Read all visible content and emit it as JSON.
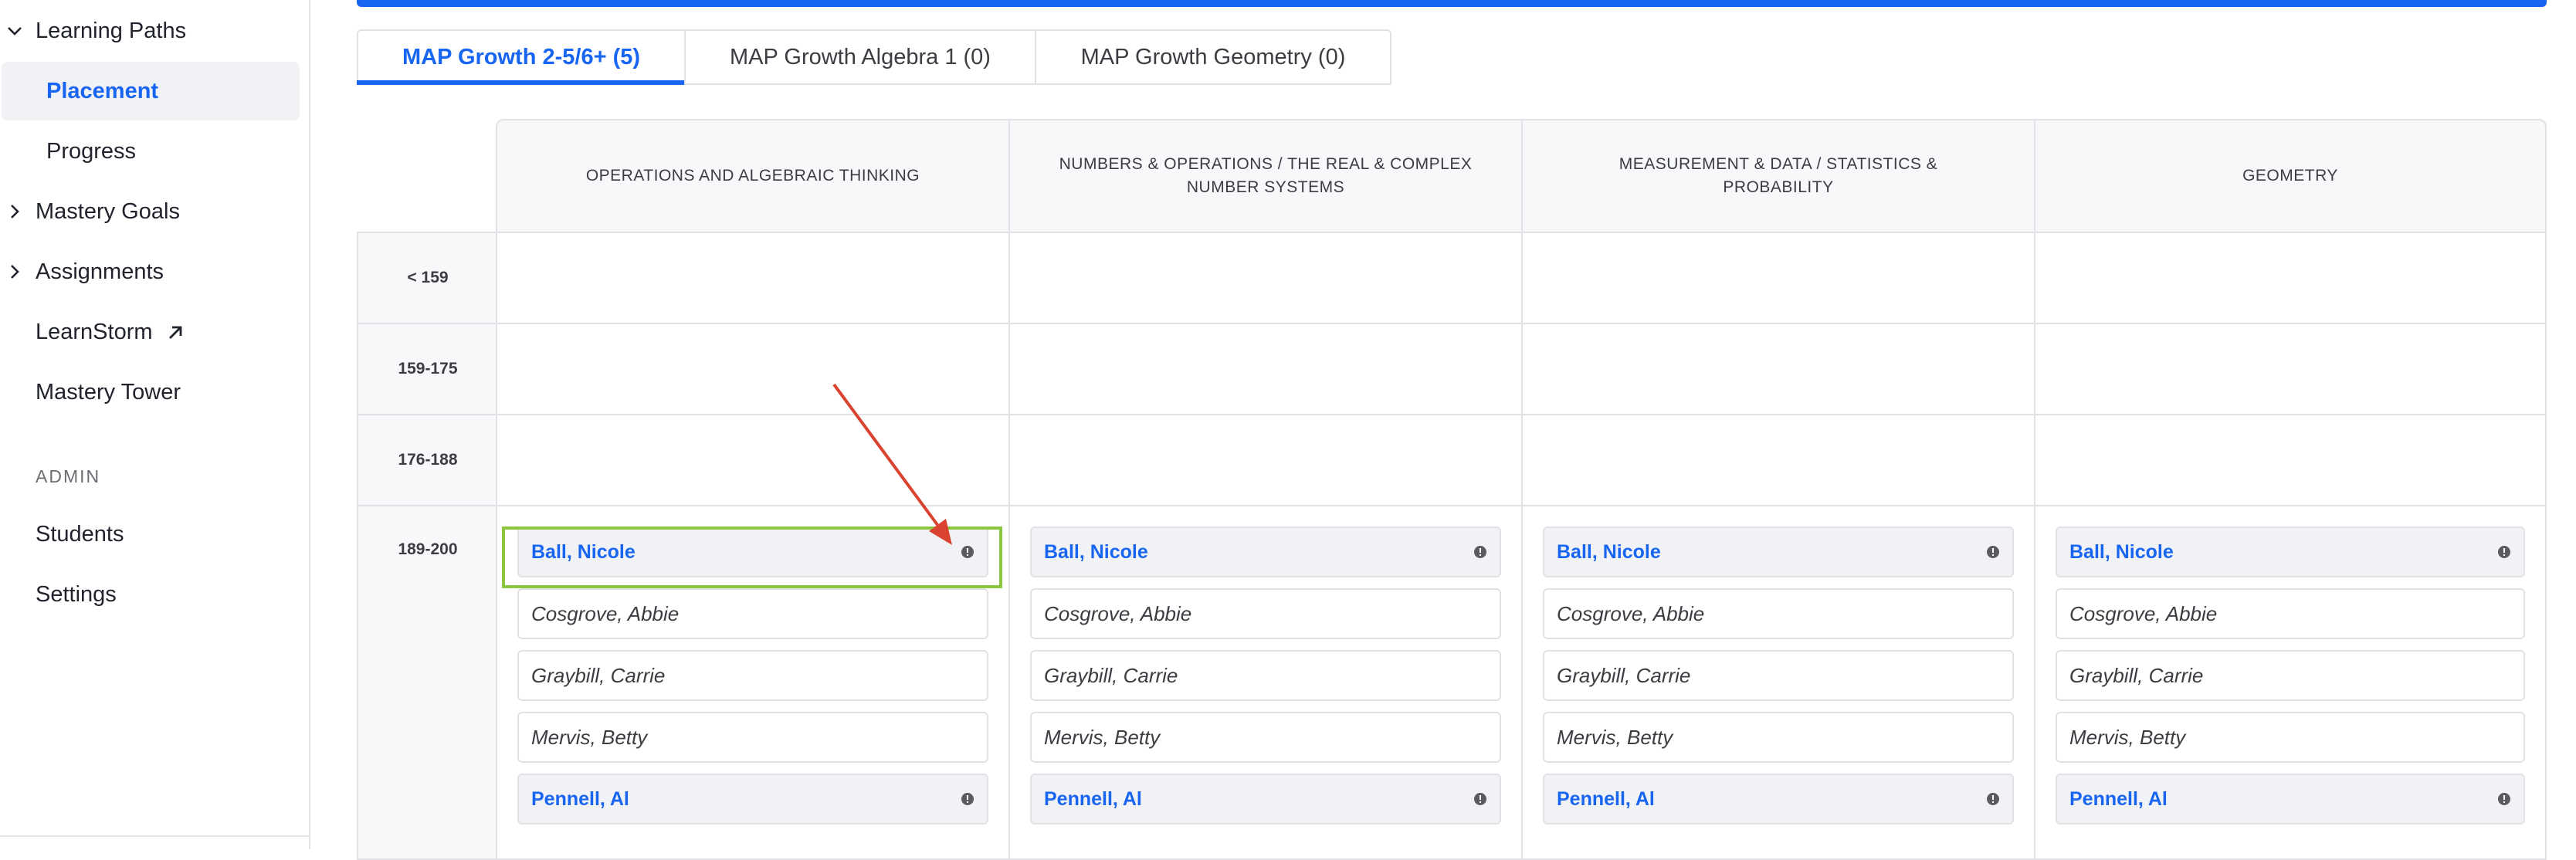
{
  "sidebar": {
    "items": [
      {
        "label": "Learning Paths",
        "icon": "chevron-down-icon"
      },
      {
        "label": "Placement"
      },
      {
        "label": "Progress"
      },
      {
        "label": "Mastery Goals",
        "icon": "chevron-right-icon"
      },
      {
        "label": "Assignments",
        "icon": "chevron-right-icon"
      },
      {
        "label": "LearnStorm",
        "icon": "external-link-icon"
      },
      {
        "label": "Mastery Tower"
      }
    ],
    "admin_title": "ADMIN",
    "admin_items": [
      {
        "label": "Students"
      },
      {
        "label": "Settings"
      }
    ]
  },
  "tabs": [
    {
      "label": "MAP Growth 2-5/6+ (5)",
      "active": true
    },
    {
      "label": "MAP Growth Algebra 1 (0)",
      "active": false
    },
    {
      "label": "MAP Growth Geometry (0)",
      "active": false
    }
  ],
  "grid": {
    "columns": [
      "OPERATIONS AND ALGEBRAIC THINKING",
      "NUMBERS & OPERATIONS / THE REAL & COMPLEX NUMBER SYSTEMS",
      "MEASUREMENT & DATA / STATISTICS & PROBABILITY",
      "GEOMETRY"
    ],
    "rows": [
      "< 159",
      "159-175",
      "176-188",
      "189-200"
    ],
    "students": [
      {
        "name": "Ball, Nicole",
        "linked": true,
        "icon": "info-icon"
      },
      {
        "name": "Cosgrove, Abbie",
        "linked": false
      },
      {
        "name": "Graybill, Carrie",
        "linked": false
      },
      {
        "name": "Mervis, Betty",
        "linked": false
      },
      {
        "name": "Pennell, Al",
        "linked": true,
        "icon": "info-icon"
      }
    ]
  },
  "colors": {
    "accent": "#1865f2",
    "highlight": "#8dc63f",
    "annotation_arrow": "#d9432f"
  }
}
